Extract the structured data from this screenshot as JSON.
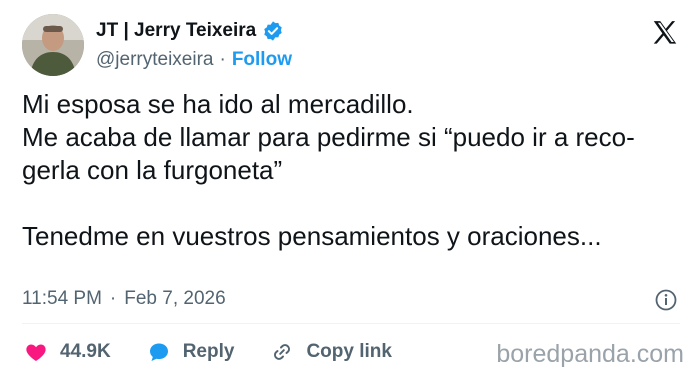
{
  "author": {
    "display_name": "JT | Jerry Teixeira",
    "handle": "@jerryteixeira",
    "separator": "·",
    "follow_label": "Follow"
  },
  "tweet": {
    "text": "Mi esposa se ha ido al mercadillo.\nMe acaba de llamar para pedirme si “puedo ir a reco-\ngerla con la furgoneta”\n\nTenedme en vuestros pensamientos y oraciones...",
    "time": "11:54 PM",
    "separator": "·",
    "date": "Feb 7, 2026"
  },
  "actions": {
    "likes_count": "44.9K",
    "reply_label": "Reply",
    "copy_link_label": "Copy link"
  },
  "watermark": "boredpanda.com",
  "colors": {
    "like": "#f91880",
    "reply": "#1d9bf0",
    "follow": "#1d9bf0",
    "verified": "#1d9bf0",
    "muted": "#536471"
  },
  "icons": [
    "verified-badge-icon",
    "x-logo-icon",
    "info-icon",
    "heart-icon",
    "reply-bubble-icon",
    "link-icon"
  ]
}
